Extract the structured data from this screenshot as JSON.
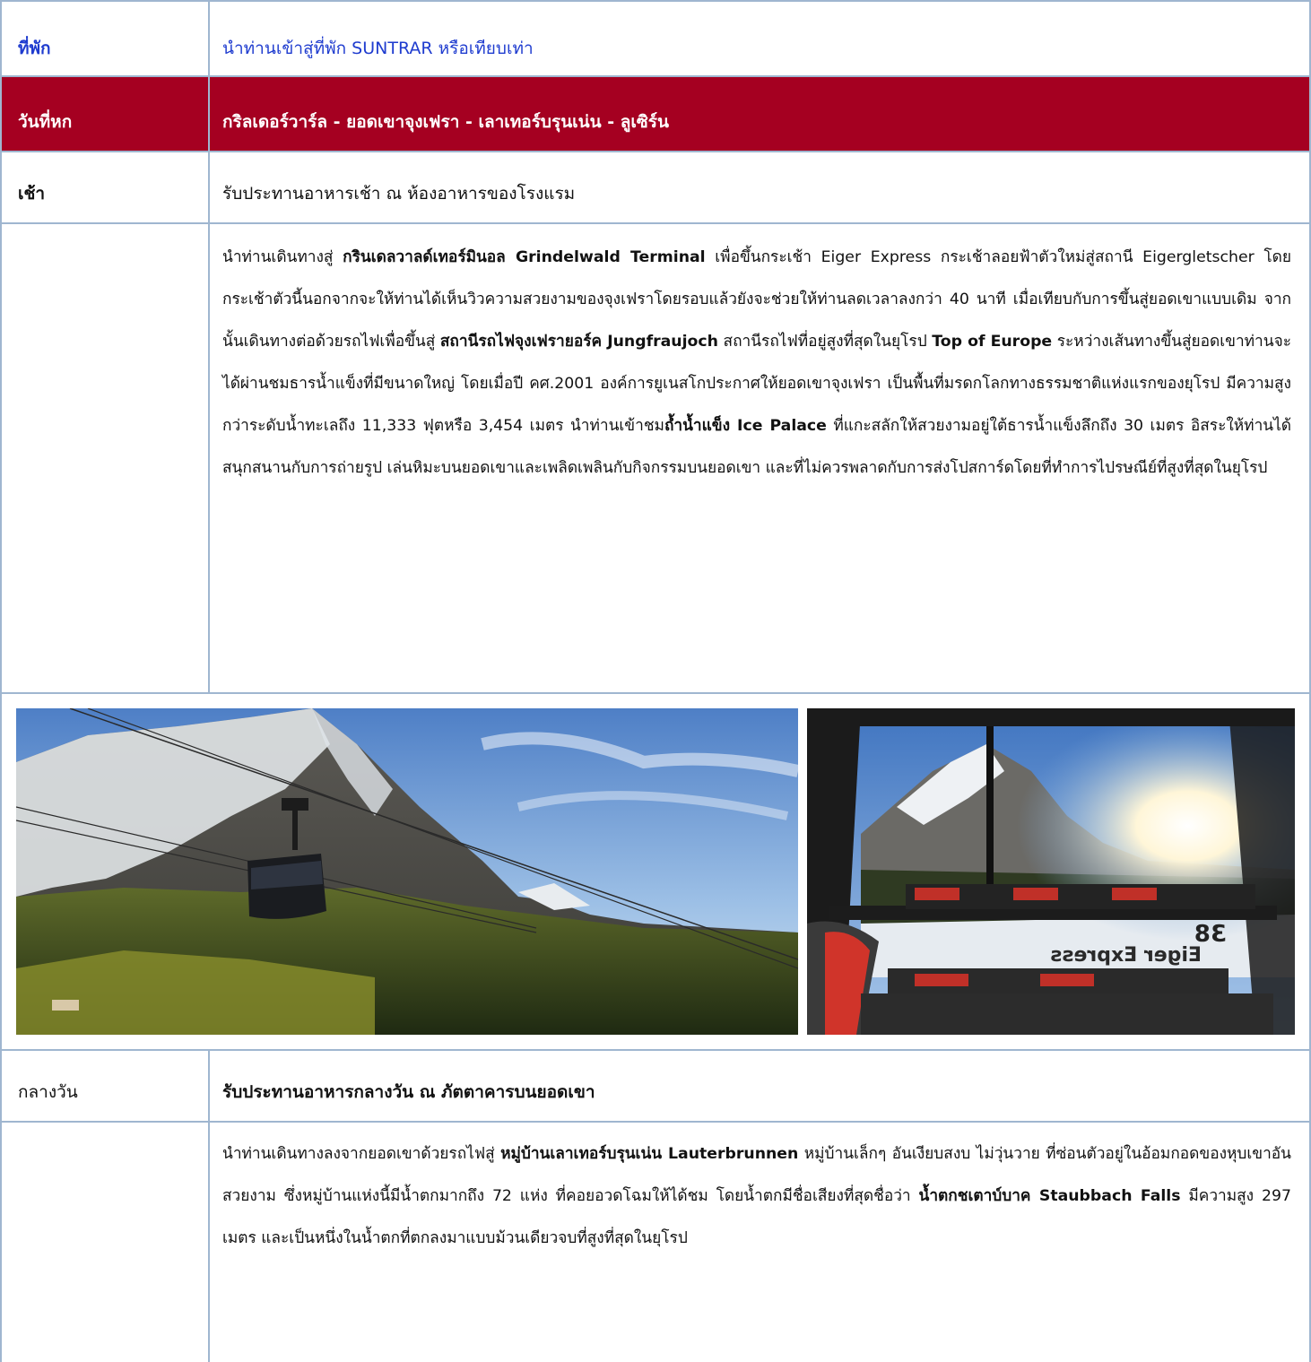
{
  "rows": {
    "accommodation": {
      "label": "ที่พัก",
      "text": "นำท่านเข้าสู่ที่พัก SUNTRAR หรือเทียบเท่า"
    },
    "day6": {
      "label": "วันที่หก",
      "title": "กริลเดอร์วาร์ล - ยอดเขาจุงเฟรา - เลาเทอร์บรุนเน่น - ลูเซิร์น",
      "band_color": "#a50021"
    },
    "breakfast": {
      "label": "เช้า",
      "text": "รับประทานอาหารเช้า ณ ห้องอาหารของโรงแรม"
    },
    "morning_desc": {
      "p1": "นำท่านเดินทางสู่ ",
      "b1": "กรินเดลวาลด์เทอร์มินอล Grindelwald Terminal",
      "p2": " เพื่อขึ้นกระเช้า Eiger Express กระเช้าลอยฟ้าตัวใหม่สู่สถานี Eigergletscher โดยกระเช้าตัวนี้นอกจากจะให้ท่านได้เห็นวิวความสวยงามของจุงเฟราโดยรอบแล้วยังจะช่วยให้ท่านลดเวลาลงกว่า 40 นาที เมื่อเทียบกับการขึ้นสู่ยอดเขาแบบเดิม จากนั้นเดินทางต่อด้วยรถไฟเพื่อขึ้นสู่ ",
      "b2": "สถานีรถไฟจุงเฟรายอร์ค Jungfraujoch",
      "p3": " สถานีรถไฟที่อยู่สูงที่สุดในยุโรป ",
      "b3": "Top of Europe",
      "p4": " ระหว่างเส้นทางขึ้นสู่ยอดเขาท่านจะได้ผ่านชมธารน้ำแข็งที่มีขนาดใหญ่ โดยเมื่อปี คศ.2001 องค์การยูเนสโกประกาศให้ยอดเขาจุงเฟรา เป็นพื้นที่มรดกโลกทางธรรมชาติแห่งแรกของยุโรป มีความสูงกว่าระดับน้ำทะเลถึง 11,333 ฟุตหรือ 3,454 เมตร นำท่านเข้าชม",
      "b4": "ถ้ำน้ำแข็ง Ice Palace",
      "p5": " ที่แกะสลักให้สวยงามอยู่ใต้ธารน้ำแข็งลึกถึง 30 เมตร อิสระให้ท่านได้สนุกสนานกับการถ่ายรูป เล่นหิมะบนยอดเขาและเพลิดเพลินกับกิจกรรมบนยอดเขา และที่ไม่ควรพลาดกับการส่งโปสการ์ดโดยที่ทำการไปรษณีย์ที่สูงที่สุดในยุโรป"
    },
    "photos": {
      "left_alt": "Eiger Express cable car gondola in front of the Eiger north face",
      "right_alt": "Interior of Eiger Express gondola cabin 38 with mountain view",
      "right_cabin_number": "38",
      "right_window_text": "Eiger Express"
    },
    "lunch": {
      "label": "กลางวัน",
      "text": "รับประทานอาหารกลางวัน ณ ภัตตาคารบนยอดเขา"
    },
    "afternoon_desc": {
      "p1": "นำท่านเดินทางลงจากยอดเขาด้วยรถไฟสู่ ",
      "b1": "หมู่บ้านเลาเทอร์บรุนเน่น Lauterbrunnen",
      "p2": " หมู่บ้านเล็กๆ อันเงียบสงบ ไม่วุ่นวาย ที่ซ่อนตัวอยู่ในอ้อมกอดของหุบเขาอันสวยงาม ซึ่งหมู่บ้านแห่งนี้มีน้ำตกมากถึง 72 แห่ง ที่คอยอวดโฉมให้ได้ชม โดยน้ำตกมีชื่อเสียงที่สุดชื่อว่า ",
      "b2": "น้ำตกชเตาบ์บาค Staubbach Falls",
      "p3": " มีความสูง 297 เมตร และเป็นหนึ่งในน้ำตกที่ตกลงมาแบบม้วนเดียวจบที่สูงที่สุดในยุโรป"
    }
  }
}
